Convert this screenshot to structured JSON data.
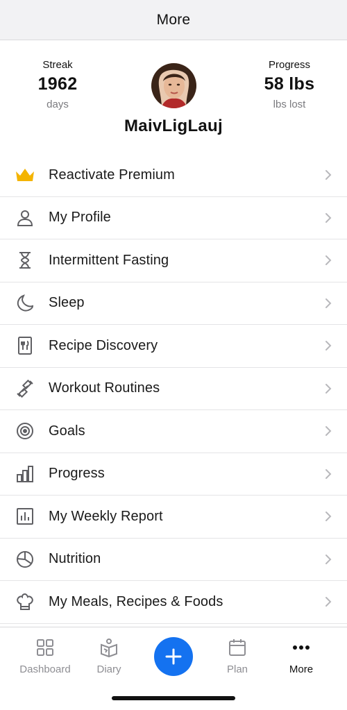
{
  "nav": {
    "title": "More"
  },
  "profile": {
    "streak": {
      "label": "Streak",
      "value": "1962",
      "unit": "days"
    },
    "progress": {
      "label": "Progress",
      "value": "58 lbs",
      "unit": "lbs lost"
    },
    "username": "MaivLigLauj"
  },
  "menu": [
    {
      "label": "Reactivate Premium",
      "icon": "crown-icon"
    },
    {
      "label": "My Profile",
      "icon": "person-icon"
    },
    {
      "label": "Intermittent Fasting",
      "icon": "hourglass-icon"
    },
    {
      "label": "Sleep",
      "icon": "moon-icon"
    },
    {
      "label": "Recipe Discovery",
      "icon": "recipe-book-icon"
    },
    {
      "label": "Workout Routines",
      "icon": "dumbbell-icon"
    },
    {
      "label": "Goals",
      "icon": "target-icon"
    },
    {
      "label": "Progress",
      "icon": "bar-chart-icon"
    },
    {
      "label": "My Weekly Report",
      "icon": "report-icon"
    },
    {
      "label": "Nutrition",
      "icon": "pie-chart-icon"
    },
    {
      "label": "My Meals, Recipes & Foods",
      "icon": "chef-hat-icon"
    }
  ],
  "tabs": {
    "dashboard": "Dashboard",
    "diary": "Diary",
    "plan": "Plan",
    "more": "More"
  },
  "colors": {
    "accent": "#1472f0",
    "crown": "#f4b400",
    "icon": "#5f5f63"
  }
}
